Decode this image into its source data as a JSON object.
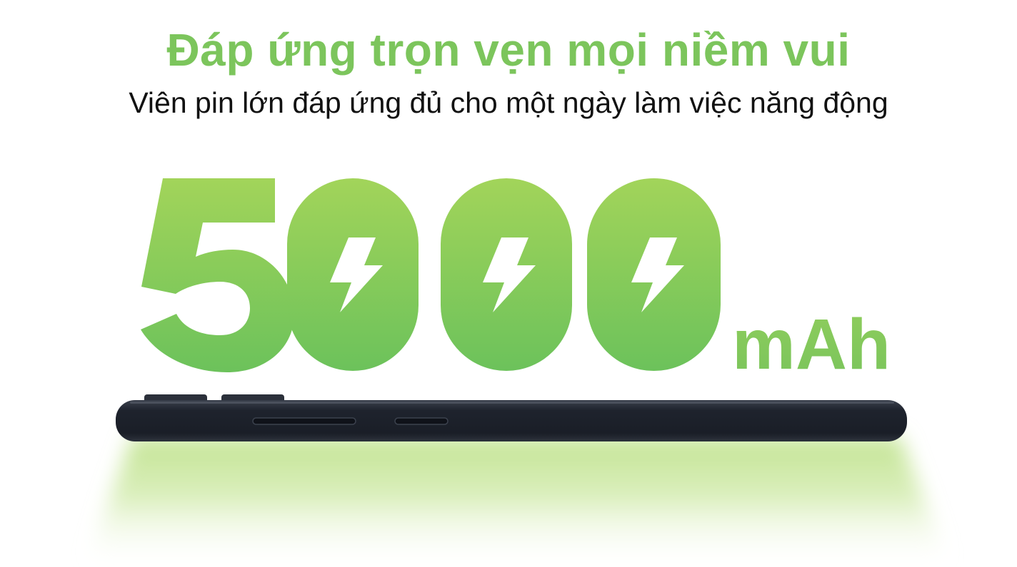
{
  "headline": "Đáp ứng trọn vẹn mọi niềm vui",
  "subheadline": "Viên pin lớn đáp ứng đủ cho một ngày làm việc năng động",
  "battery": {
    "capacity_digits": [
      "5",
      "0",
      "0",
      "0"
    ],
    "unit": "mAh",
    "bolt_icon": "lightning-bolt-icon"
  },
  "colors": {
    "accent_green": "#7cc55c",
    "digit_green_top": "#9fd35b",
    "digit_green_bottom": "#6cc35a",
    "phone_body": "#1c212b",
    "glow_green": "#c9e79e"
  }
}
